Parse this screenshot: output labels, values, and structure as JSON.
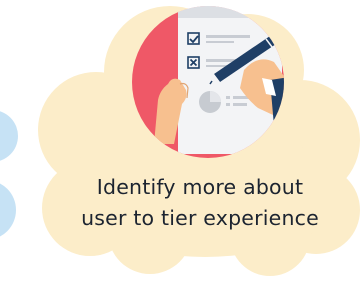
{
  "card": {
    "caption_lines": [
      "Identify more about",
      "user to tier experience"
    ]
  },
  "illustration": {
    "icon": "checklist-document-with-pen-icon",
    "checklist_marks": [
      "check-mark",
      "x-mark"
    ],
    "colors": {
      "cloud": "#fcedc9",
      "side_bubble": "#c6e2f5",
      "circle": "#ef5867",
      "paper": "#f3f4f6",
      "pen_body": "#1f3f66",
      "skin": "#f7c08f"
    }
  }
}
